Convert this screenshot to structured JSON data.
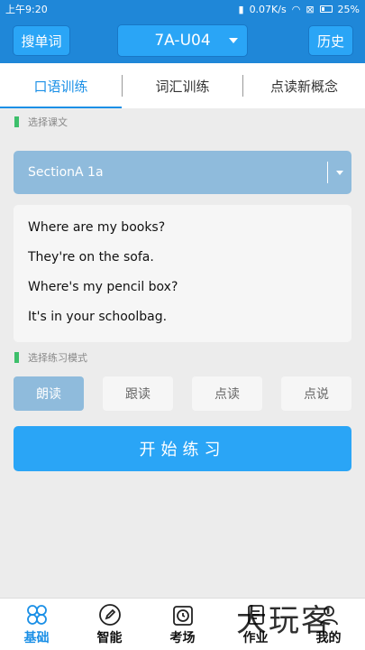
{
  "status_bar": {
    "time": "上午9:20",
    "speed": "0.07K/s",
    "battery": "25%"
  },
  "header": {
    "search_label": "搜单词",
    "unit_value": "7A-U04",
    "history_label": "历史"
  },
  "tabs": [
    {
      "label": "口语训练",
      "active": true
    },
    {
      "label": "词汇训练",
      "active": false
    },
    {
      "label": "点读新概念",
      "active": false
    }
  ],
  "lesson_section": {
    "title": "选择课文",
    "selected_lesson": "SectionA 1a"
  },
  "content_lines": [
    "Where are my books?",
    "They're on the sofa.",
    "Where's my pencil box?",
    "It's in your schoolbag."
  ],
  "mode_section": {
    "title": "选择练习模式",
    "modes": [
      {
        "label": "朗读",
        "active": true
      },
      {
        "label": "跟读",
        "active": false
      },
      {
        "label": "点读",
        "active": false
      },
      {
        "label": "点说",
        "active": false
      }
    ]
  },
  "start_button": "开始练习",
  "bottom_nav": [
    {
      "label": "基础",
      "icon": "grid-icon",
      "active": true
    },
    {
      "label": "智能",
      "icon": "pencil-icon",
      "active": false
    },
    {
      "label": "考场",
      "icon": "clock-icon",
      "active": false
    },
    {
      "label": "作业",
      "icon": "homework-icon",
      "active": false
    },
    {
      "label": "我的",
      "icon": "person-icon",
      "active": false
    }
  ],
  "watermark": "大玩客",
  "colors": {
    "primary": "#1f87d8",
    "accent": "#2aa5f6",
    "selected": "#8fbbdc",
    "green_mark": "#3dbf6b"
  }
}
